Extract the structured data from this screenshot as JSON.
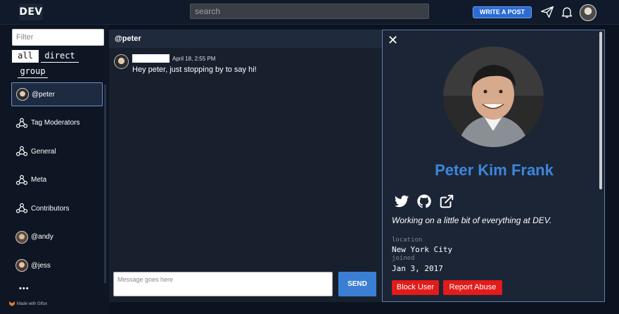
{
  "topbar": {
    "logo": "DEV",
    "search_placeholder": "search",
    "write_post_label": "WRITE A POST",
    "icons": [
      "paper-plane-icon",
      "bell-icon"
    ]
  },
  "sidebar": {
    "filter_placeholder": "Filter",
    "tabs": [
      "all",
      "direct",
      "group"
    ],
    "active_tab": "all",
    "channels": [
      {
        "label": "@peter",
        "type": "direct",
        "active": true
      },
      {
        "label": "Tag Moderators",
        "type": "group"
      },
      {
        "label": "General",
        "type": "group"
      },
      {
        "label": "Meta",
        "type": "group"
      },
      {
        "label": "Contributors",
        "type": "group"
      },
      {
        "label": "@andy",
        "type": "direct"
      },
      {
        "label": "@jess",
        "type": "direct"
      }
    ],
    "more": "•••",
    "made_with": "Made with Glfox"
  },
  "chat": {
    "header": "@peter",
    "message": {
      "time": "April 18, 2:55 PM",
      "text": "Hey peter, just stopping by to say hi!"
    },
    "input_placeholder": "Message goes here",
    "send_label": "SEND"
  },
  "profile": {
    "close": "✕",
    "name": "Peter Kim Frank",
    "social_icons": [
      "twitter-icon",
      "github-icon",
      "external-link-icon"
    ],
    "bio": "Working on a little bit of everything at DEV.",
    "location_label": "location",
    "location": "New York City",
    "joined_label": "joined",
    "joined": "Jan 3, 2017",
    "block_label": "Block User",
    "report_label": "Report Abuse"
  },
  "colors": {
    "accent": "#3d86db",
    "danger": "#e21b1b",
    "panel": "#1b2536"
  }
}
